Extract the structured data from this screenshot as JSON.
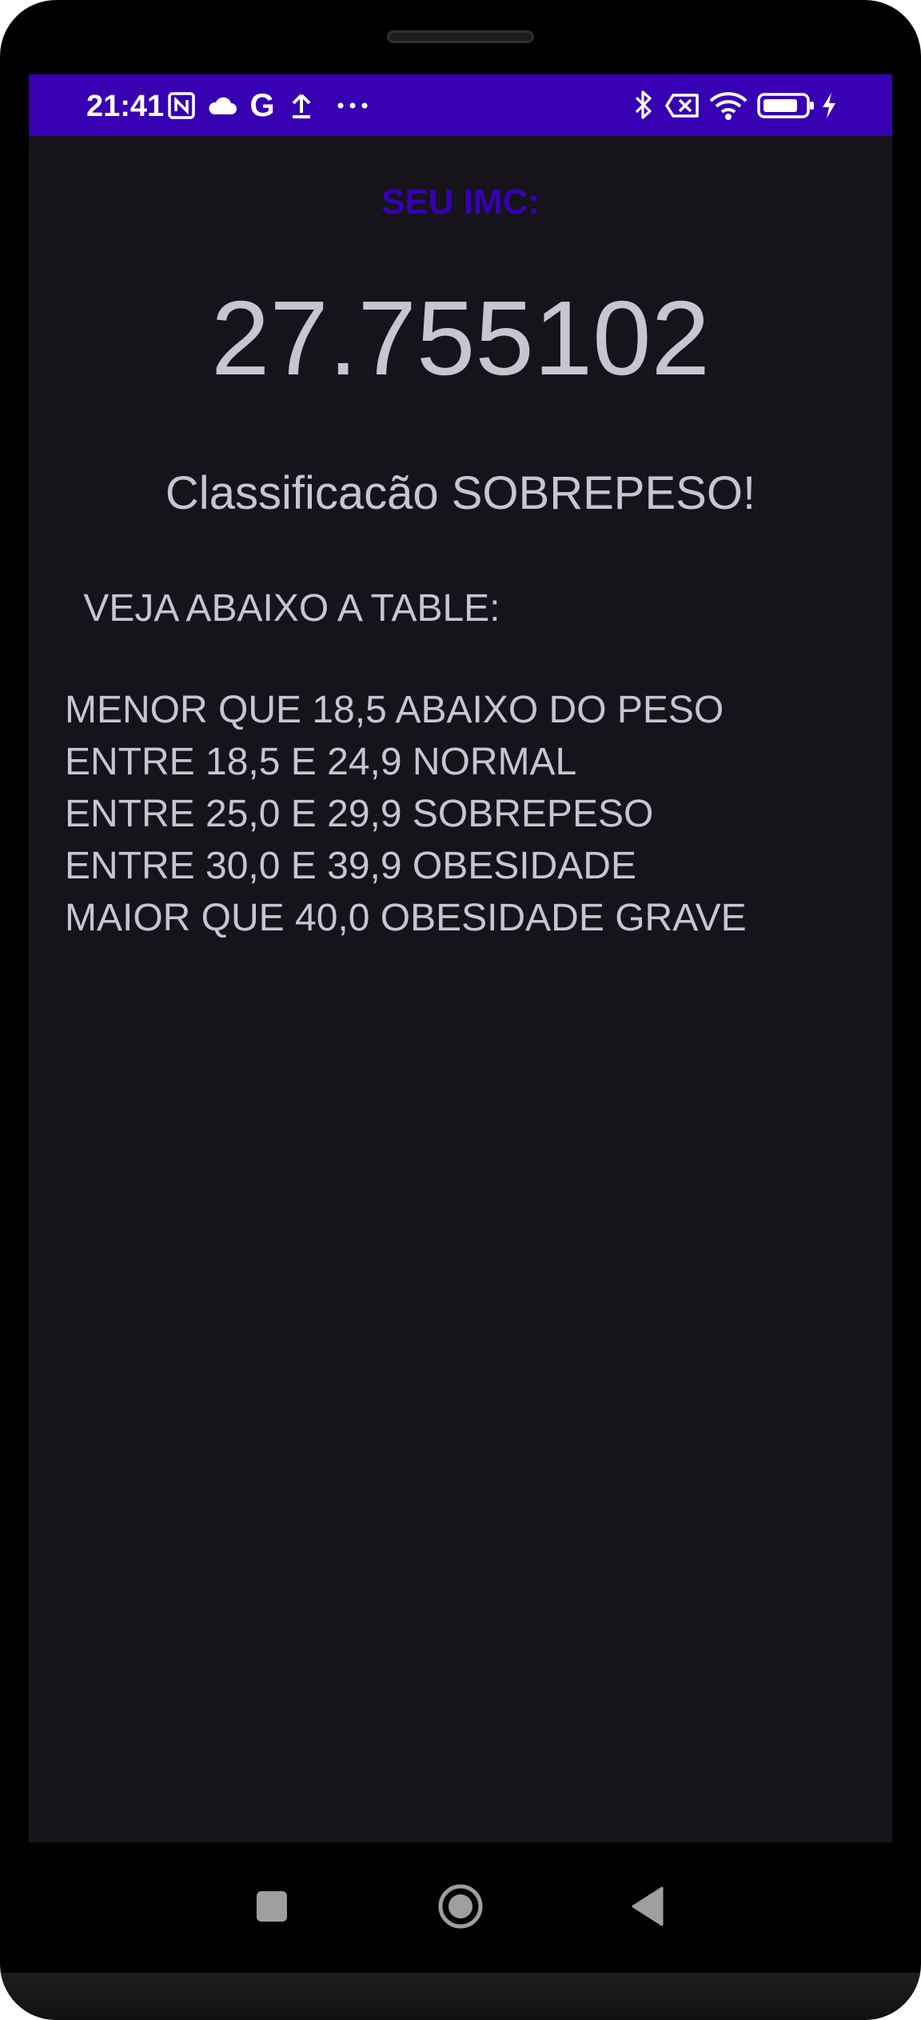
{
  "status_bar": {
    "time": "21:41",
    "left_icons": [
      "nfc-icon",
      "cloud-icon",
      "google-icon",
      "upload-icon",
      "more-notifications-icon"
    ],
    "right_icons": [
      "bluetooth-icon",
      "no-sim-icon",
      "wifi-icon",
      "battery-icon",
      "charging-icon"
    ],
    "background_color": "#3700b3"
  },
  "main": {
    "imc_label": "SEU IMC:",
    "imc_value": "27.755102",
    "classification": "Classificacão SOBREPESO!",
    "table_title": " VEJA ABAIXO A TABLE:",
    "table_rows": [
      "MENOR QUE 18,5 ABAIXO DO PESO",
      "ENTRE 18,5 E 24,9 NORMAL",
      "ENTRE 25,0 E 29,9 SOBREPESO",
      "ENTRE 30,0 E 39,9 OBESIDADE",
      "MAIOR QUE 40,0 OBESIDADE GRAVE"
    ],
    "accent_color": "#3700b3",
    "text_color": "#c9c5cf",
    "background_color": "#16141a"
  },
  "nav_bar": {
    "buttons": [
      "recent-apps-icon",
      "home-icon",
      "back-icon"
    ]
  }
}
